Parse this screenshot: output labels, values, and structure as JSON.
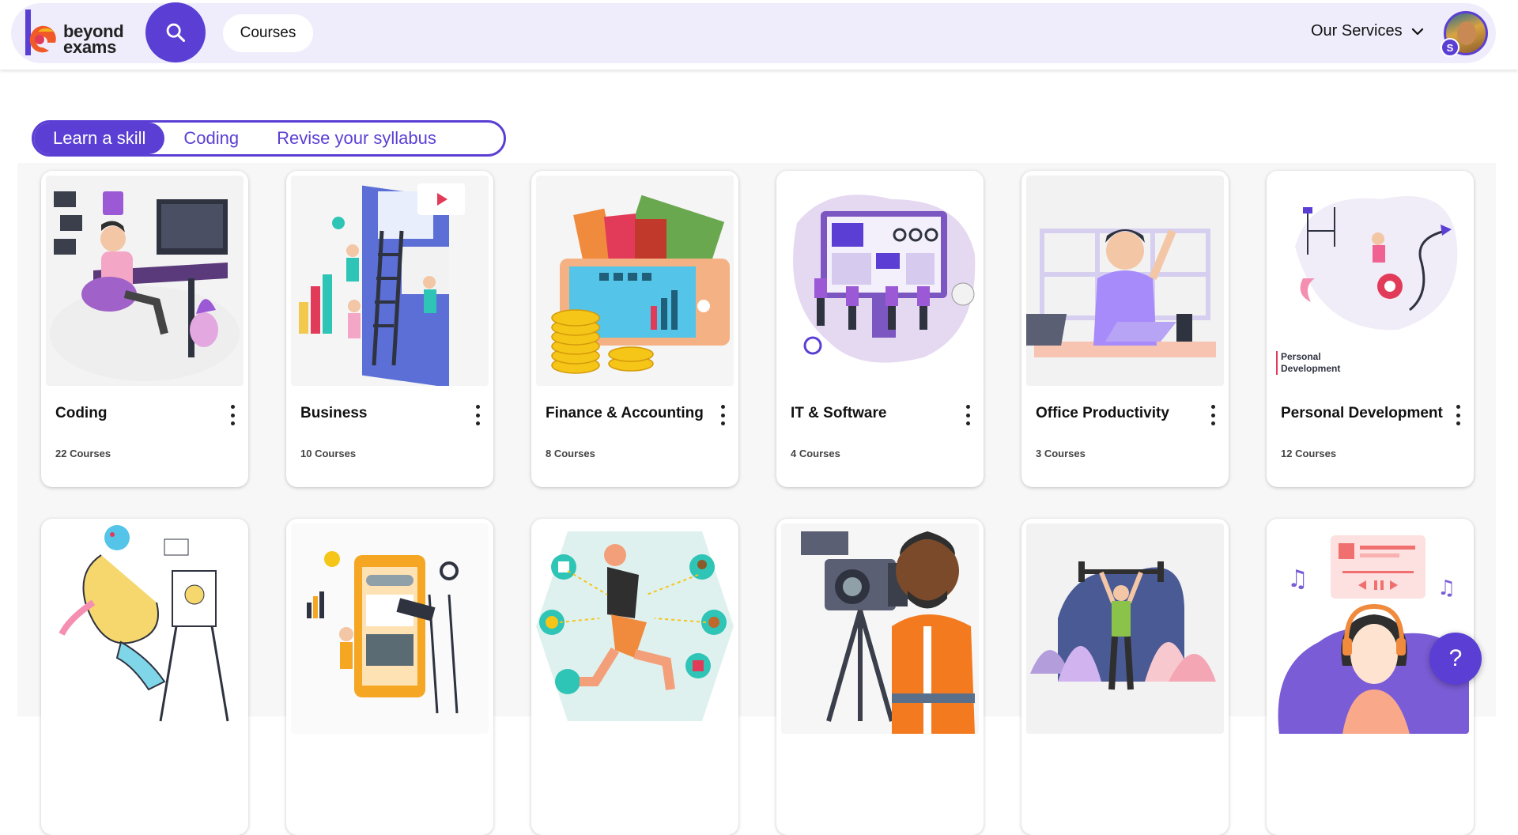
{
  "brand": {
    "line1": "beyond",
    "line2": "exams"
  },
  "header": {
    "courses_label": "Courses",
    "services_label": "Our Services",
    "avatar_badge": "S"
  },
  "tabs": [
    {
      "label": "Learn a skill",
      "active": true
    },
    {
      "label": "Coding",
      "active": false
    },
    {
      "label": "Revise your syllabus",
      "active": false
    }
  ],
  "cards": [
    {
      "title": "Coding",
      "count": "22 Courses",
      "illustration": "coding-illustration"
    },
    {
      "title": "Business",
      "count": "10 Courses",
      "illustration": "business-illustration"
    },
    {
      "title": "Finance & Accounting",
      "count": "8 Courses",
      "illustration": "finance-illustration"
    },
    {
      "title": "IT & Software",
      "count": "4 Courses",
      "illustration": "it-software-illustration"
    },
    {
      "title": "Office Productivity",
      "count": "3 Courses",
      "illustration": "office-illustration"
    },
    {
      "title": "Personal Development",
      "count": "12 Courses",
      "illustration": "personal-development-illustration",
      "image_caption_line1": "Personal",
      "image_caption_line2": "Development"
    },
    {
      "illustration": "art-illustration"
    },
    {
      "illustration": "marketing-illustration"
    },
    {
      "illustration": "health-illustration"
    },
    {
      "illustration": "photography-illustration"
    },
    {
      "illustration": "fitness-illustration"
    },
    {
      "illustration": "music-illustration"
    }
  ],
  "help_label": "?",
  "colors": {
    "accent": "#5b3fd4",
    "header_bg": "#efedfb"
  }
}
